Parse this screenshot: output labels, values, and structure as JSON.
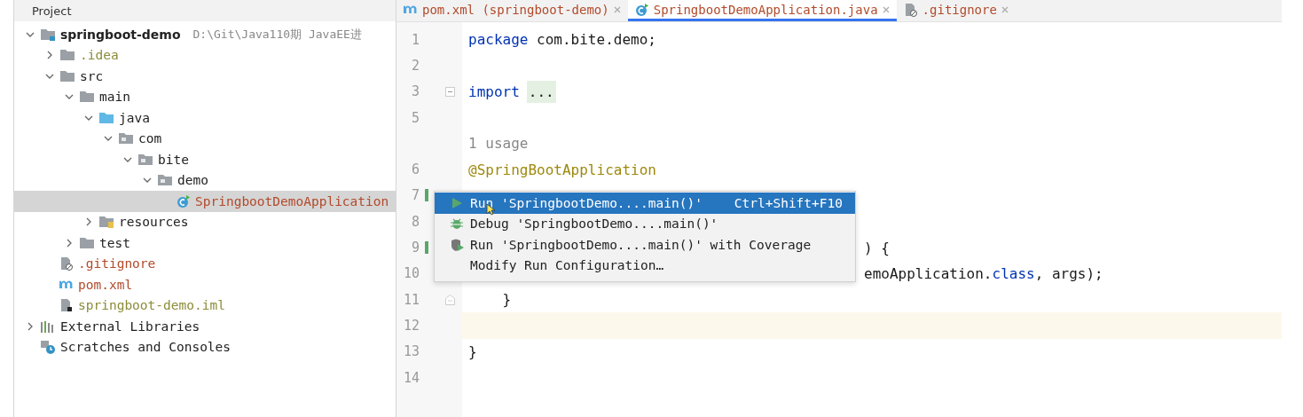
{
  "project_panel": {
    "title": "Project",
    "tree": [
      {
        "label": "springboot-demo",
        "kind": "module",
        "hint": "D:\\Git\\Java110期 JavaEE进",
        "selected": false,
        "expanded": true,
        "children": [
          {
            "label": ".idea",
            "kind": "folder",
            "color": "#8c8c3a",
            "selected": false,
            "expanded": false
          },
          {
            "label": "src",
            "kind": "folder",
            "selected": false,
            "expanded": true,
            "children": [
              {
                "label": "main",
                "kind": "folder",
                "selected": false,
                "expanded": true,
                "children": [
                  {
                    "label": "java",
                    "kind": "source-folder",
                    "selected": false,
                    "expanded": true,
                    "children": [
                      {
                        "label": "com",
                        "kind": "package",
                        "selected": false,
                        "expanded": true,
                        "children": [
                          {
                            "label": "bite",
                            "kind": "package",
                            "selected": false,
                            "expanded": true,
                            "children": [
                              {
                                "label": "demo",
                                "kind": "package",
                                "selected": false,
                                "expanded": true,
                                "children": [
                                  {
                                    "label": "SpringbootDemoApplication",
                                    "kind": "class",
                                    "color": "#b24a2a",
                                    "selected": true
                                  }
                                ]
                              }
                            ]
                          }
                        ]
                      }
                    ]
                  },
                  {
                    "label": "resources",
                    "kind": "resources-folder",
                    "selected": false,
                    "expanded": false
                  }
                ]
              },
              {
                "label": "test",
                "kind": "folder",
                "selected": false,
                "expanded": false
              }
            ]
          },
          {
            "label": ".gitignore",
            "kind": "gitignore",
            "color": "#b24a2a",
            "selected": false
          },
          {
            "label": "pom.xml",
            "kind": "maven",
            "color": "#b24a2a",
            "selected": false
          },
          {
            "label": "springboot-demo.iml",
            "kind": "iml",
            "color": "#8c8c3a",
            "selected": false
          }
        ]
      },
      {
        "label": "External Libraries",
        "kind": "libraries",
        "selected": false,
        "expanded": false
      },
      {
        "label": "Scratches and Consoles",
        "kind": "scratches",
        "selected": false
      }
    ]
  },
  "editor": {
    "tabs": [
      {
        "label": "pom.xml (springboot-demo)",
        "kind": "maven",
        "selected": false
      },
      {
        "label": "SpringbootDemoApplication.java",
        "kind": "class",
        "selected": true
      },
      {
        "label": ".gitignore",
        "kind": "gitignore",
        "selected": false
      }
    ],
    "lines": [
      {
        "number": "1",
        "segments": [
          {
            "kind": "keyword",
            "text": "package"
          },
          {
            "kind": "plain",
            "text": " com.bite.demo;"
          }
        ]
      },
      {
        "number": "2"
      },
      {
        "number": "3",
        "fold_start": true,
        "segments": [
          {
            "kind": "keyword",
            "text": "import"
          },
          {
            "kind": "folded",
            "text": "..."
          }
        ]
      },
      {
        "number": "5"
      },
      {
        "segments": [
          {
            "kind": "hint",
            "text": "1 usage"
          }
        ]
      },
      {
        "number": "6",
        "segments": [
          {
            "kind": "annotation",
            "text": "@SpringBootApplication"
          }
        ]
      },
      {
        "number": "7",
        "run_marker": true
      },
      {
        "number": "8"
      },
      {
        "number": "9",
        "run_marker": true,
        "segments": [
          {
            "kind": "beside-popup",
            "text": ") {"
          }
        ]
      },
      {
        "number": "10",
        "segments": [
          {
            "kind": "beside-popup",
            "text": "emoApplication."
          },
          {
            "kind": "keyword",
            "text": "class"
          },
          {
            "kind": "plain",
            "text": ", args);"
          }
        ]
      },
      {
        "number": "11",
        "fold_end": true,
        "segments": [
          {
            "kind": "plain",
            "text": "    }"
          }
        ]
      },
      {
        "number": "12",
        "current": true
      },
      {
        "number": "13",
        "segments": [
          {
            "kind": "plain",
            "text": "}"
          }
        ]
      },
      {
        "number": "14"
      }
    ],
    "popup": {
      "items": [
        {
          "kind": "run",
          "label": "Run 'SpringbootDemo....main()'",
          "shortcut": "Ctrl+Shift+F10",
          "selected": true
        },
        {
          "kind": "debug",
          "label": "Debug 'SpringbootDemo....main()'",
          "selected": false
        },
        {
          "kind": "coverage",
          "label": "Run 'SpringbootDemo....main()' with Coverage",
          "selected": false
        },
        {
          "kind": "plain",
          "label": "Modify Run Configuration…",
          "selected": false
        }
      ]
    }
  }
}
